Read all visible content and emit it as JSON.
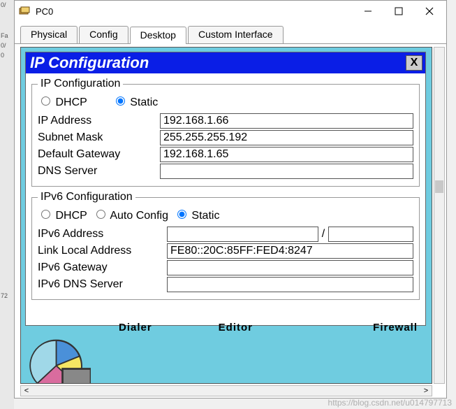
{
  "window": {
    "title": "PC0"
  },
  "tabs": {
    "physical": "Physical",
    "config": "Config",
    "desktop": "Desktop",
    "custom": "Custom Interface",
    "active": "desktop"
  },
  "cfg": {
    "header": "IP Configuration",
    "close": "X",
    "ipv4": {
      "legend": "IP Configuration",
      "radio_dhcp": "DHCP",
      "radio_static": "Static",
      "mode": "static",
      "ip_label": "IP Address",
      "ip_value": "192.168.1.66",
      "subnet_label": "Subnet Mask",
      "subnet_value": "255.255.255.192",
      "gateway_label": "Default Gateway",
      "gateway_value": "192.168.1.65",
      "dns_label": "DNS Server",
      "dns_value": ""
    },
    "ipv6": {
      "legend": "IPv6 Configuration",
      "radio_dhcp": "DHCP",
      "radio_auto": "Auto Config",
      "radio_static": "Static",
      "mode": "static",
      "addr_label": "IPv6 Address",
      "addr_value": "",
      "prefix_value": "",
      "ll_label": "Link Local Address",
      "ll_value": "FE80::20C:85FF:FED4:8247",
      "gateway_label": "IPv6 Gateway",
      "gateway_value": "",
      "dns_label": "IPv6 DNS Server",
      "dns_value": ""
    }
  },
  "strip": {
    "dialer": "Dialer",
    "editor": "Editor",
    "firewall": "Firewall"
  },
  "watermark": "https://blog.csdn.net/u014797713",
  "edge": {
    "a": "0/",
    "b": "Fa",
    "c": "0/",
    "d": "0",
    "e": "72"
  }
}
